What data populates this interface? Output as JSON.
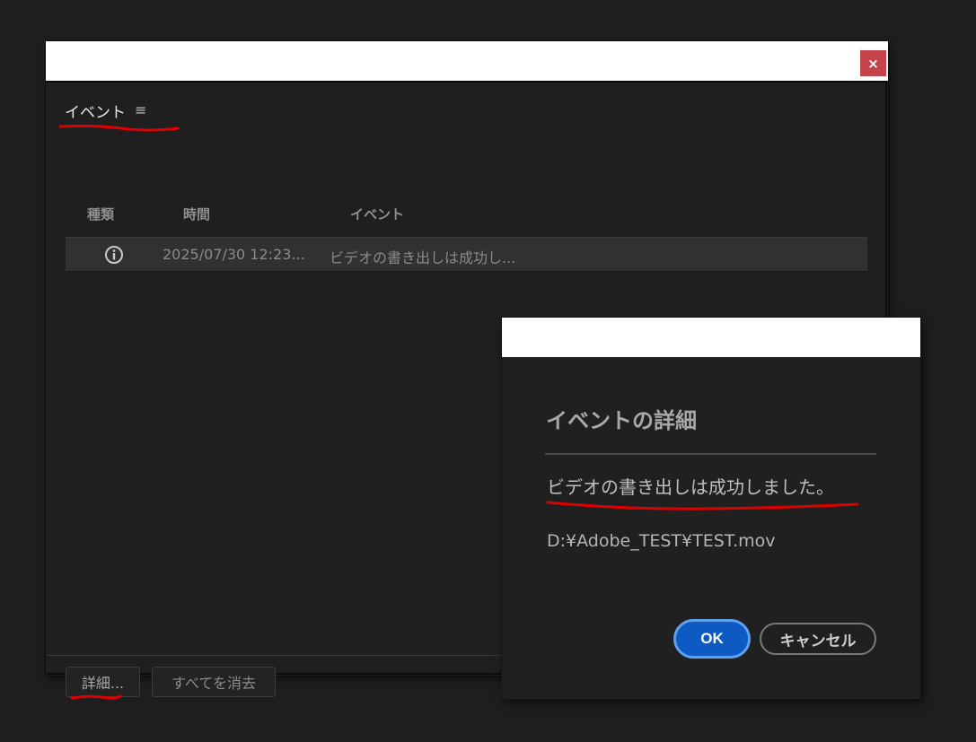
{
  "events_panel": {
    "close_label": "×",
    "title": "イベント",
    "menu_icon": "hamburger-menu-icon",
    "columns": {
      "type": "種類",
      "time": "時間",
      "event": "イベント"
    },
    "rows": [
      {
        "icon": "info-icon",
        "time": "2025/07/30 12:23...",
        "event": "ビデオの書き出しは成功し..."
      }
    ],
    "details_button": "詳細...",
    "clear_all_button": "すべてを消去"
  },
  "event_details_dialog": {
    "title": "イベントの詳細",
    "message": "ビデオの書き出しは成功しました。",
    "path": "D:¥Adobe_TEST¥TEST.mov",
    "ok_button": "OK",
    "cancel_button": "キャンセル"
  },
  "colors": {
    "background": "#1e1e1e",
    "close_button": "#c4424a",
    "ok_button": "#0d5ac3",
    "annotation_underline": "#e00000"
  }
}
